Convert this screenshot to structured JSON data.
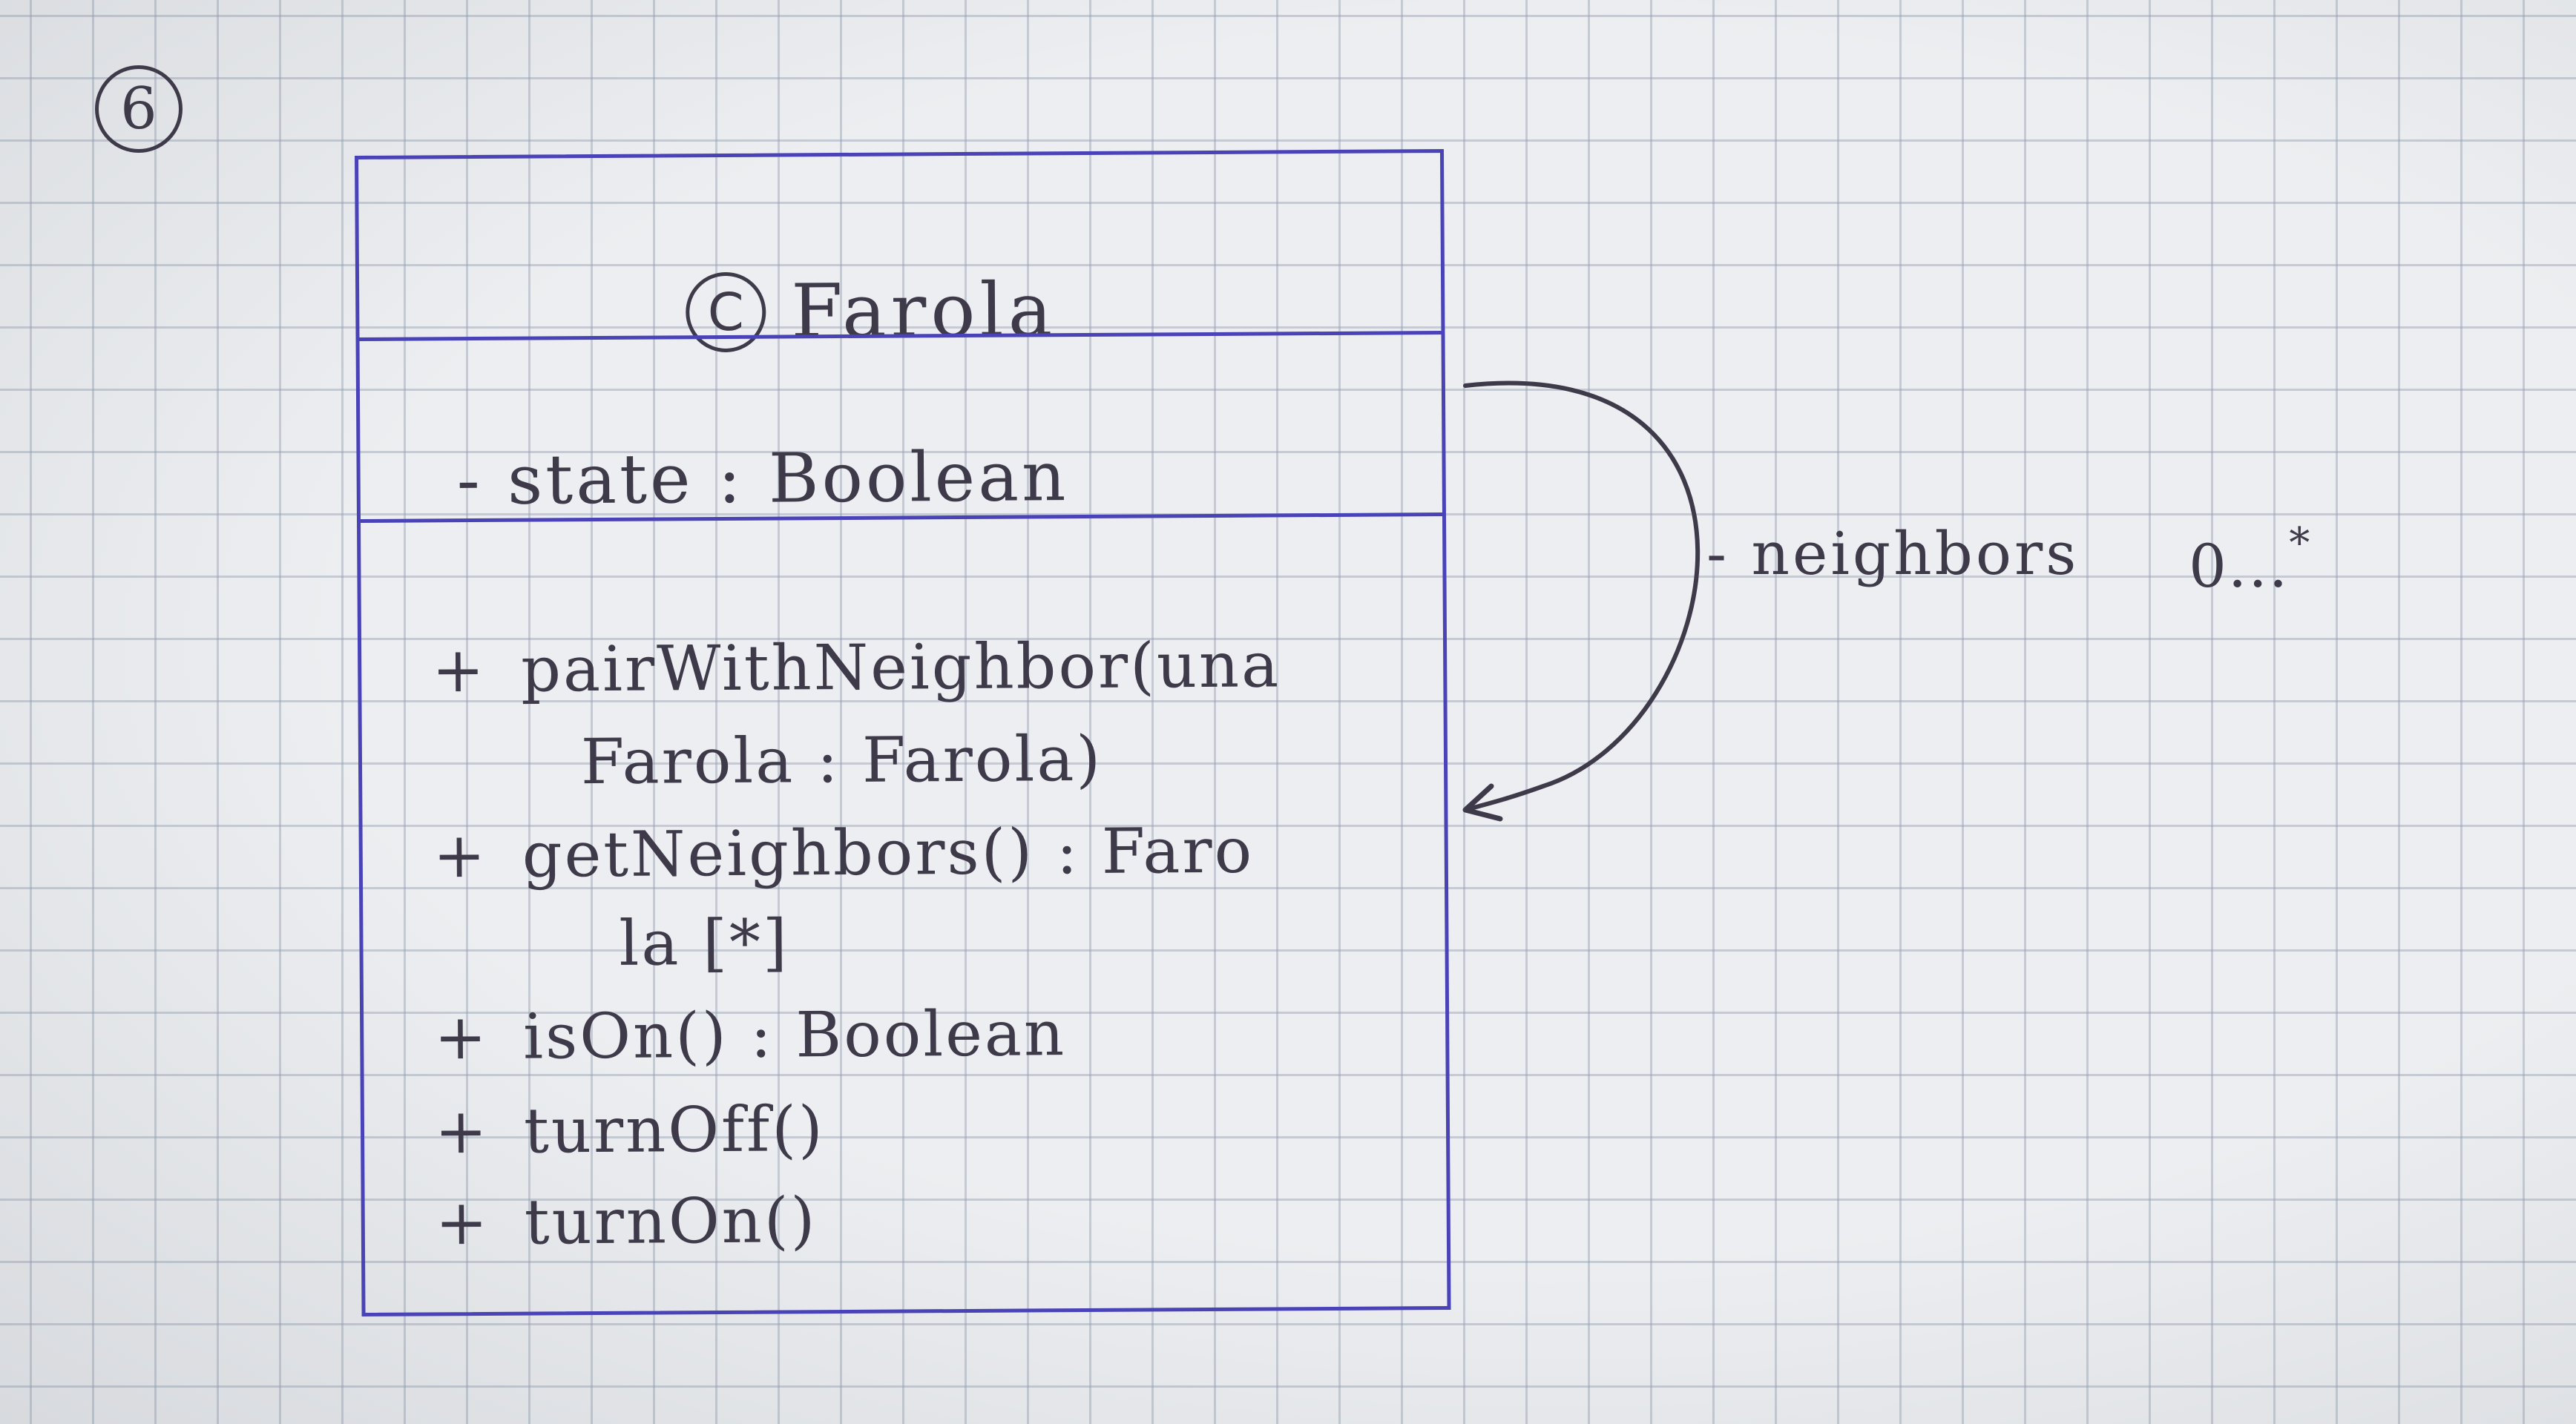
{
  "diagram_number": "6",
  "class": {
    "stereotype": "C",
    "name": "Farola"
  },
  "attributes": [
    "- state : Boolean"
  ],
  "methods": [
    {
      "visibility": "+",
      "lines": [
        "pairWithNeighbor(una",
        "Farola : Farola)"
      ]
    },
    {
      "visibility": "+",
      "lines": [
        "getNeighbors() : Faro",
        "la [*]"
      ]
    },
    {
      "visibility": "+",
      "lines": [
        "isOn() : Boolean"
      ]
    },
    {
      "visibility": "+",
      "lines": [
        "turnOff()"
      ]
    },
    {
      "visibility": "+",
      "lines": [
        "turnOn()"
      ]
    }
  ],
  "association": {
    "role": "- neighbors",
    "multiplicity_lower": "0...",
    "multiplicity_upper": "*"
  },
  "colors": {
    "paper": "#eceef1",
    "grid": "#969fae",
    "pen_blue": "#4a43b8",
    "pencil": "#3f3a4a"
  }
}
